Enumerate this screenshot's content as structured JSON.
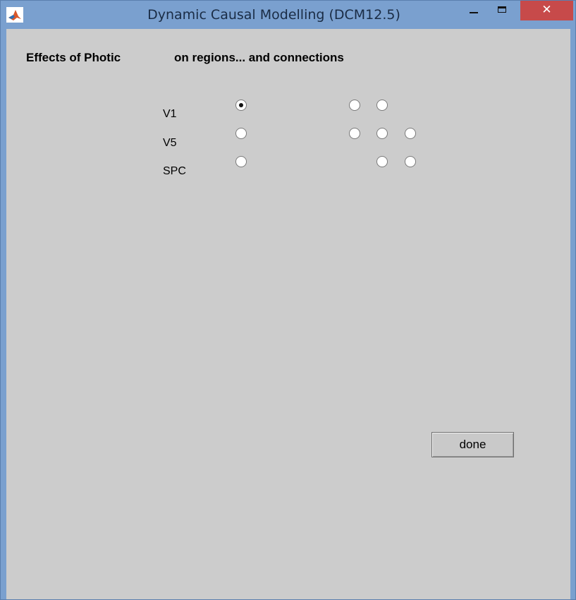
{
  "window": {
    "title": "Dynamic Causal Modelling (DCM12.5)",
    "app_icon": "matlab-icon",
    "close_glyph": "✕",
    "accent_color": "#7aa0cf",
    "close_color": "#c74a4a"
  },
  "header": {
    "effects_label": "Effects of Photic",
    "regions_label": "on regions... and connections"
  },
  "regions": [
    {
      "label": "V1",
      "checked": true
    },
    {
      "label": "V5",
      "checked": false
    },
    {
      "label": "SPC",
      "checked": false
    }
  ],
  "connections": [
    [
      false,
      false
    ],
    [
      false,
      false,
      false
    ],
    [
      false,
      false
    ]
  ],
  "done_label": "done"
}
